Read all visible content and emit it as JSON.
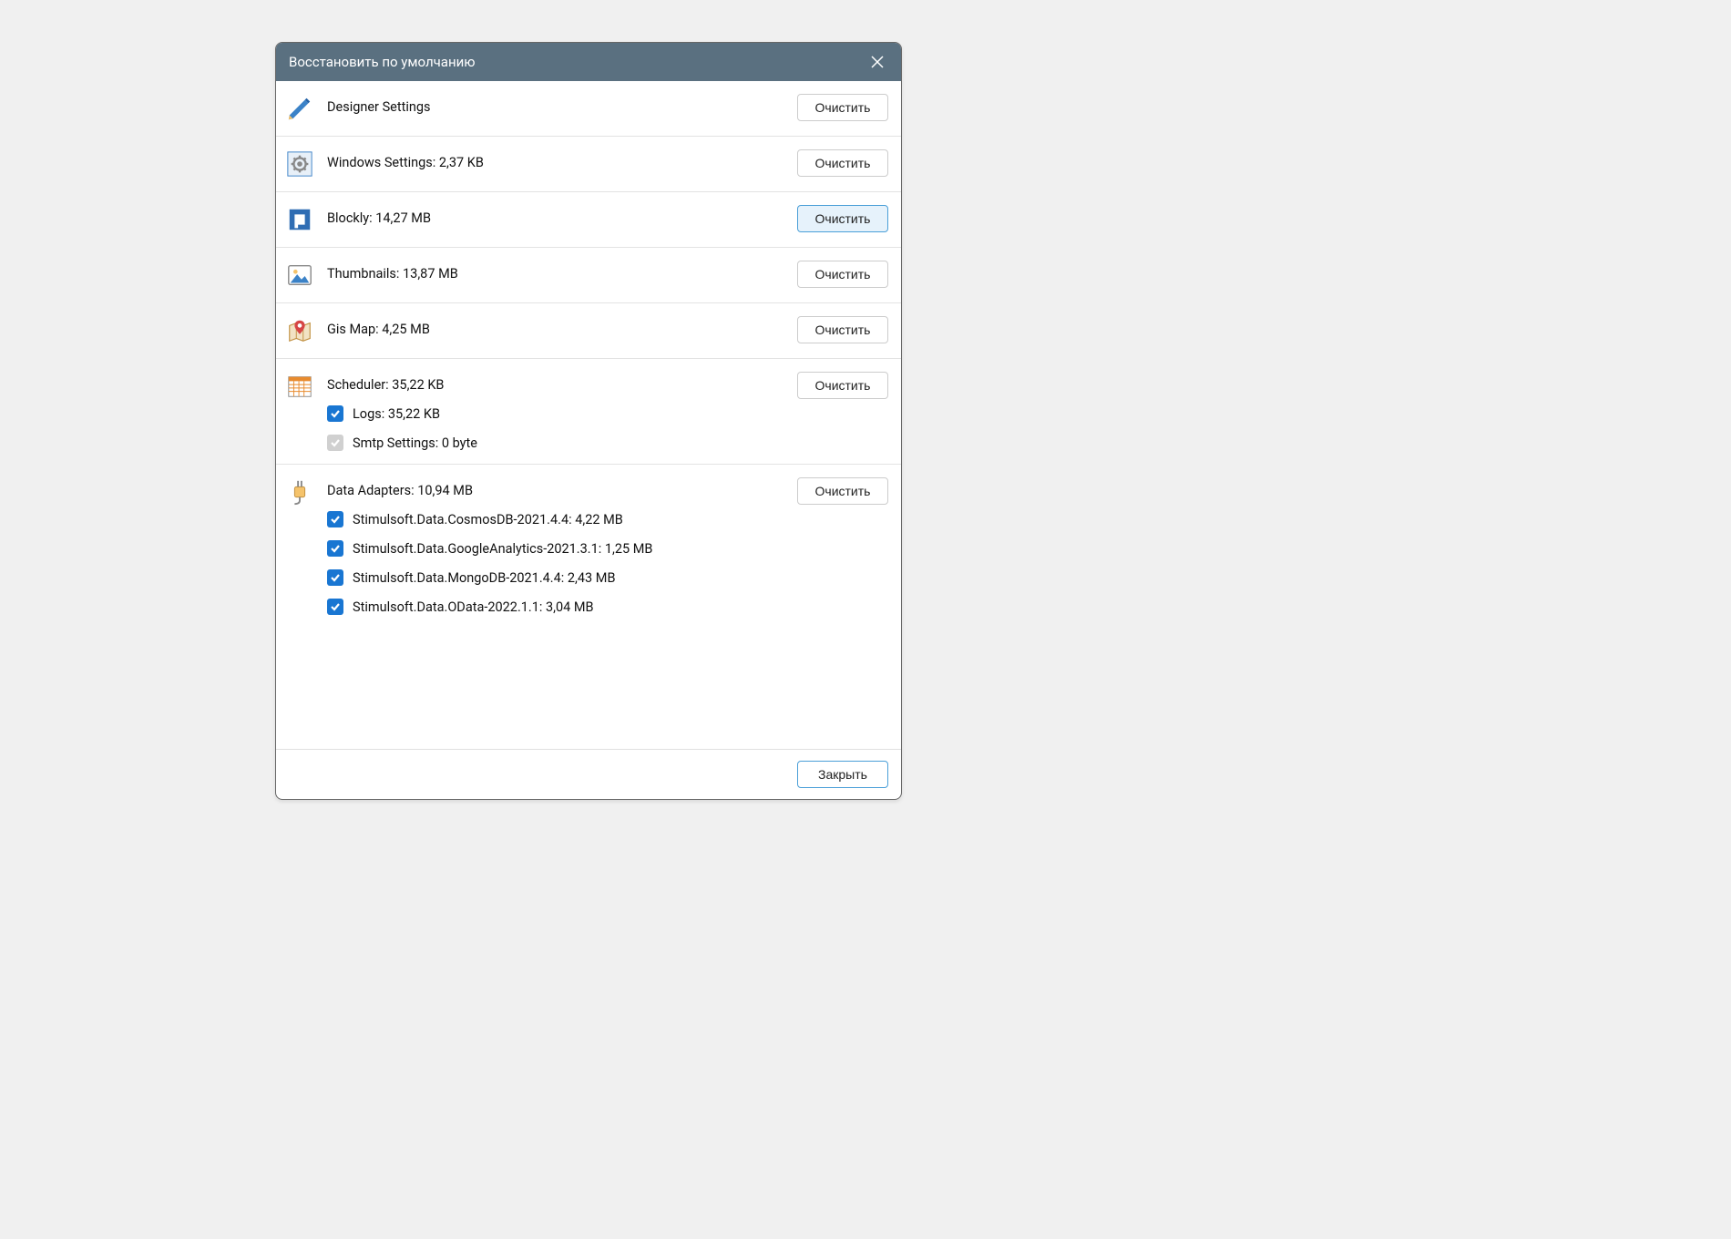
{
  "title": "Восстановить по умолчанию",
  "clear_label": "Очистить",
  "close_label": "Закрыть",
  "rows": {
    "designer": {
      "label": "Designer Settings"
    },
    "windows": {
      "label": "Windows Settings: 2,37 KB"
    },
    "blockly": {
      "label": "Blockly: 14,27 MB"
    },
    "thumbs": {
      "label": "Thumbnails: 13,87 MB"
    },
    "gismap": {
      "label": "Gis Map: 4,25 MB"
    },
    "scheduler": {
      "label": "Scheduler: 35,22 KB",
      "subs": {
        "logs": {
          "label": "Logs: 35,22 KB",
          "checked": true,
          "disabled": false
        },
        "smtp": {
          "label": "Smtp Settings: 0 byte",
          "checked": true,
          "disabled": true
        }
      }
    },
    "adapters": {
      "label": "Data Adapters: 10,94 MB",
      "subs": {
        "a0": {
          "label": "Stimulsoft.Data.CosmosDB-2021.4.4: 4,22 MB"
        },
        "a1": {
          "label": "Stimulsoft.Data.GoogleAnalytics-2021.3.1: 1,25 MB"
        },
        "a2": {
          "label": "Stimulsoft.Data.MongoDB-2021.4.4: 2,43 MB"
        },
        "a3": {
          "label": "Stimulsoft.Data.OData-2022.1.1: 3,04 MB"
        }
      }
    }
  }
}
